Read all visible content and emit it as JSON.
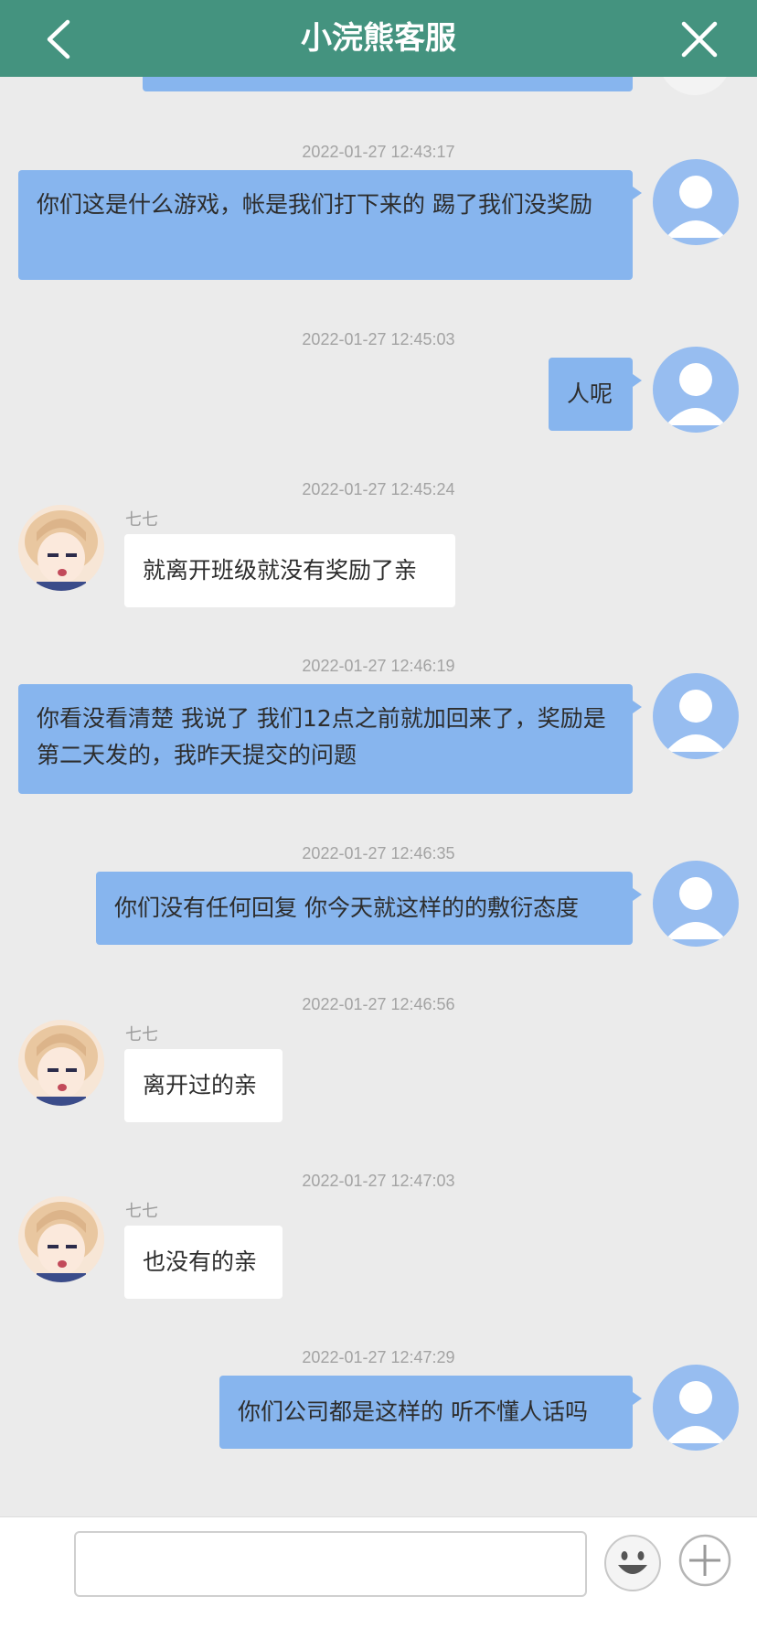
{
  "header": {
    "title": "小浣熊客服",
    "back_icon": "chevron-left-icon",
    "close_icon": "close-icon"
  },
  "colors": {
    "header_bg": "#44937f",
    "outgoing_bubble": "#87b5ee",
    "incoming_bubble": "#ffffff",
    "chat_bg": "#ebebeb"
  },
  "messages": [
    {
      "timestamp": "2022-01-27 12:43:17",
      "direction": "out",
      "text": "你们这是什么游戏，帐是我们打下来的 踢了我们没奖励"
    },
    {
      "timestamp": "2022-01-27 12:45:03",
      "direction": "out",
      "text": "人呢"
    },
    {
      "timestamp": "2022-01-27 12:45:24",
      "direction": "in",
      "sender": "七七",
      "text": "就离开班级就没有奖励了亲"
    },
    {
      "timestamp": "2022-01-27 12:46:19",
      "direction": "out",
      "text": "你看没看清楚 我说了 我们12点之前就加回来了，奖励是第二天发的，我昨天提交的问题"
    },
    {
      "timestamp": "2022-01-27 12:46:35",
      "direction": "out",
      "text": "你们没有任何回复 你今天就这样的的敷衍态度"
    },
    {
      "timestamp": "2022-01-27 12:46:56",
      "direction": "in",
      "sender": "七七",
      "text": "离开过的亲"
    },
    {
      "timestamp": "2022-01-27 12:47:03",
      "direction": "in",
      "sender": "七七",
      "text": "也没有的亲"
    },
    {
      "timestamp": "2022-01-27 12:47:29",
      "direction": "out",
      "text": "你们公司都是这样的 听不懂人话吗"
    }
  ],
  "composer": {
    "input_value": "",
    "emoji_icon": "emoji-icon",
    "plus_icon": "plus-icon"
  }
}
